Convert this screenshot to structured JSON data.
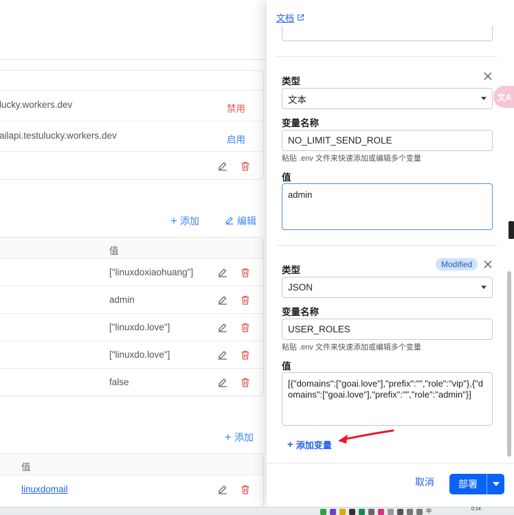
{
  "background": {
    "domains": [
      {
        "name": "lucky.workers.dev",
        "action": "禁用",
        "action_color": "#e05a4f"
      },
      {
        "name": "ailapi.testulucky.workers.dev",
        "action": "启用",
        "action_color": "#3b82f6"
      }
    ],
    "vars_section": {
      "add_label": "添加",
      "edit_label": "编辑",
      "value_header": "值",
      "rows": [
        {
          "value": "[\"linuxdoxiaohuang\"]"
        },
        {
          "value": "admin"
        },
        {
          "value": "[\"linuxdo.love\"]"
        },
        {
          "value": "[\"linuxdo.love\"]"
        },
        {
          "value": "false"
        }
      ]
    },
    "kv_section": {
      "add_label": "添加",
      "value_header": "值",
      "rows": [
        {
          "value": "linuxdomail"
        }
      ]
    }
  },
  "drawer": {
    "doc_link": "文档",
    "var1": {
      "type_label": "类型",
      "type_value": "文本",
      "name_label": "变量名称",
      "name_value": "NO_LIMIT_SEND_ROLE",
      "hint": "粘贴 .env 文件来快速添加或编辑多个变量",
      "value_label": "值",
      "value": "admin"
    },
    "var2": {
      "badge": "Modified",
      "type_label": "类型",
      "type_value": "JSON",
      "name_label": "变量名称",
      "name_value": "USER_ROLES",
      "hint": "粘贴 .env 文件来快速添加或编辑多个变量",
      "value_label": "值",
      "value": "[{\"domains\":[\"goai.love\"],\"prefix\":\"\",\"role\":\"vip\"},{\"domains\":[\"goai.love\"],\"prefix\":\"\",\"role\":\"admin\"}]"
    },
    "add_variable": "添加变量",
    "cancel": "取消",
    "deploy": "部署"
  },
  "floating": {
    "translate": "文A"
  },
  "taskbar": {
    "time": "0:14",
    "ime": "中"
  },
  "colors": {
    "accent": "#0b63f6",
    "danger": "#e05a4f",
    "badge_bg": "#cfe2fb"
  }
}
